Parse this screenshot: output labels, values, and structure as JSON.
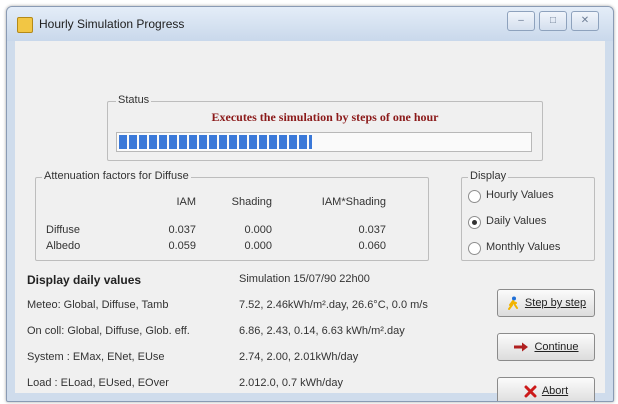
{
  "window": {
    "title": "Hourly Simulation Progress",
    "minimize_glyph": "–",
    "maximize_glyph": "□",
    "close_glyph": "✕"
  },
  "status": {
    "legend": "Status",
    "message": "Executes the simulation by steps of one hour",
    "progress_fraction": 0.47
  },
  "attenuation": {
    "legend": "Attenuation factors for Diffuse",
    "headers": [
      "IAM",
      "Shading",
      "IAM*Shading"
    ],
    "rows": [
      {
        "label": "Diffuse",
        "values": [
          "0.037",
          "0.000",
          "0.037"
        ]
      },
      {
        "label": "Albedo",
        "values": [
          "0.059",
          "0.000",
          "0.060"
        ]
      }
    ]
  },
  "display": {
    "legend": "Display",
    "options": [
      {
        "label": "Hourly Values",
        "selected": false
      },
      {
        "label": "Daily Values",
        "selected": true
      },
      {
        "label": "Monthly Values",
        "selected": false
      }
    ]
  },
  "info": {
    "heading": "Display daily values",
    "simulation": "Simulation 15/07/90 22h00",
    "rows": [
      {
        "label": "Meteo: Global, Diffuse, Tamb",
        "value": "7.52, 2.46kWh/m².day, 26.6°C, 0.0 m/s"
      },
      {
        "label": "On coll: Global, Diffuse, Glob. eff.",
        "value": "6.86, 2.43, 0.14, 6.63 kWh/m².day"
      },
      {
        "label": "System : EMax, ENet, EUse",
        "value": "2.74, 2.00, 2.01kWh/day"
      },
      {
        "label": "Load : ELoad, EUsed, EOver",
        "value": "2.012.0, 0.7 kWh/day"
      }
    ]
  },
  "buttons": {
    "step": {
      "label": "Step by step",
      "icon": "runner-icon"
    },
    "continue": {
      "label": "Continue",
      "icon": "arrow-right-icon"
    },
    "abort": {
      "label": "Abort",
      "icon": "red-x-icon"
    }
  },
  "colors": {
    "status_text": "#8b1a1a",
    "progress": "#3a78d8",
    "abort_icon": "#cc1a1a",
    "continue_icon": "#b02020"
  }
}
